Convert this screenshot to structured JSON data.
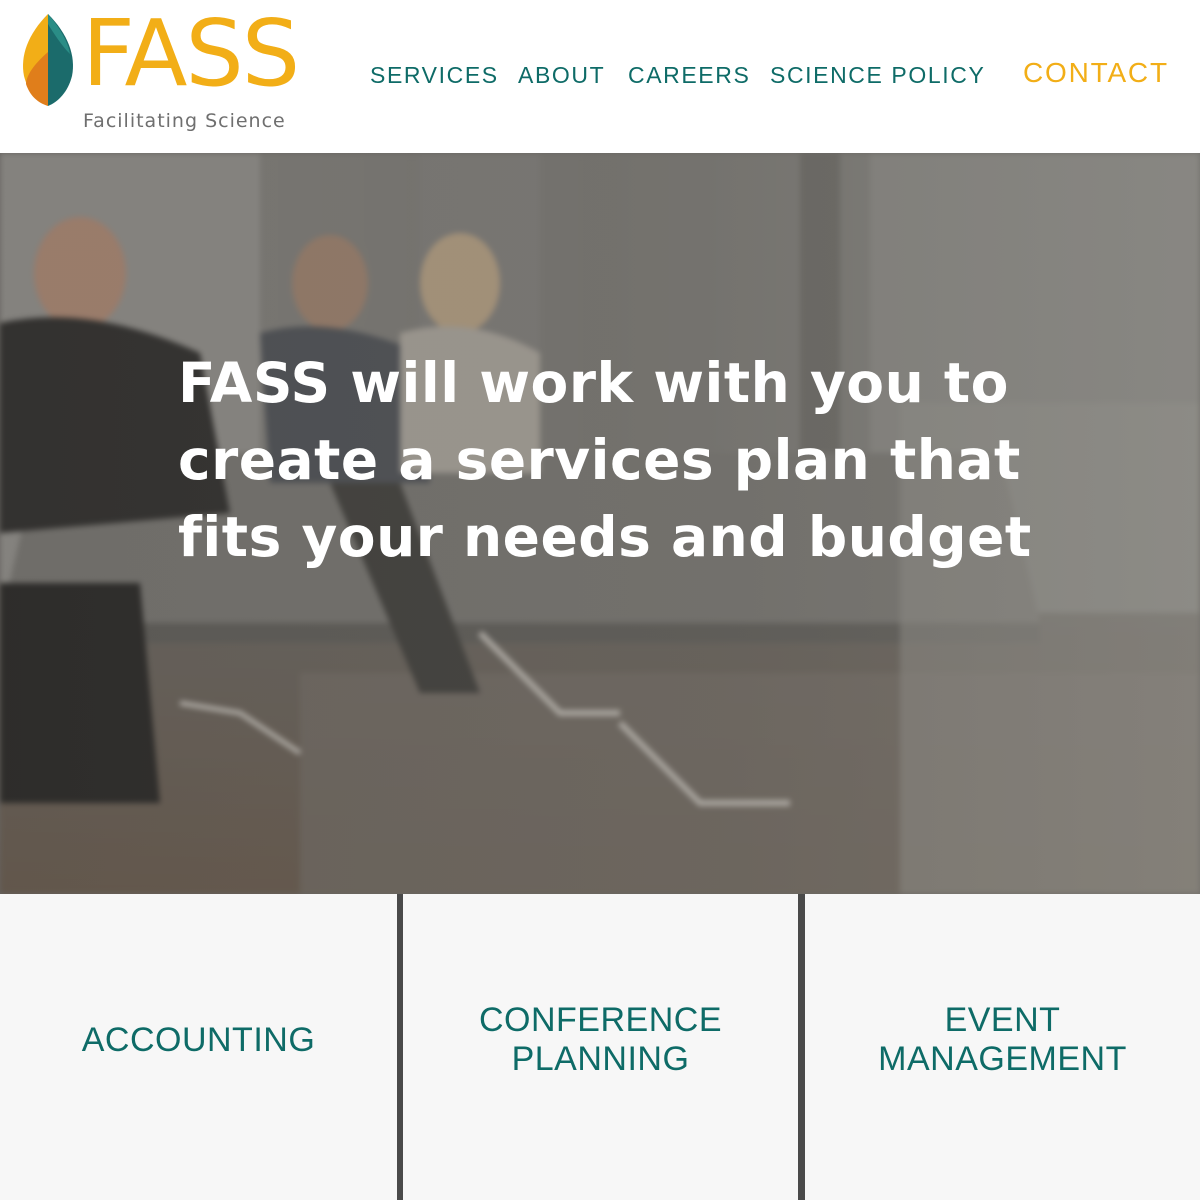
{
  "brand": {
    "name": "FASS",
    "tagline": "Facilitating Science",
    "logo_icon": "leaf-logo-icon",
    "colors": {
      "primary_teal": "#0e6b67",
      "accent_gold": "#f2ae17",
      "leaf_orange": "#e07e1b",
      "leaf_dark_teal": "#1b6b6b"
    }
  },
  "nav": {
    "services": "SERVICES",
    "about": "ABOUT",
    "careers": "CAREERS",
    "science_policy": "SCIENCE POLICY",
    "contact": "CONTACT"
  },
  "hero": {
    "headline": "FASS will work with you to create a services plan that fits your needs and budget",
    "background_description_icon": "meeting-photo"
  },
  "tiles": [
    {
      "label": "ACCOUNTING"
    },
    {
      "label": "CONFERENCE\nPLANNING"
    },
    {
      "label": "EVENT\nMANAGEMENT"
    }
  ]
}
